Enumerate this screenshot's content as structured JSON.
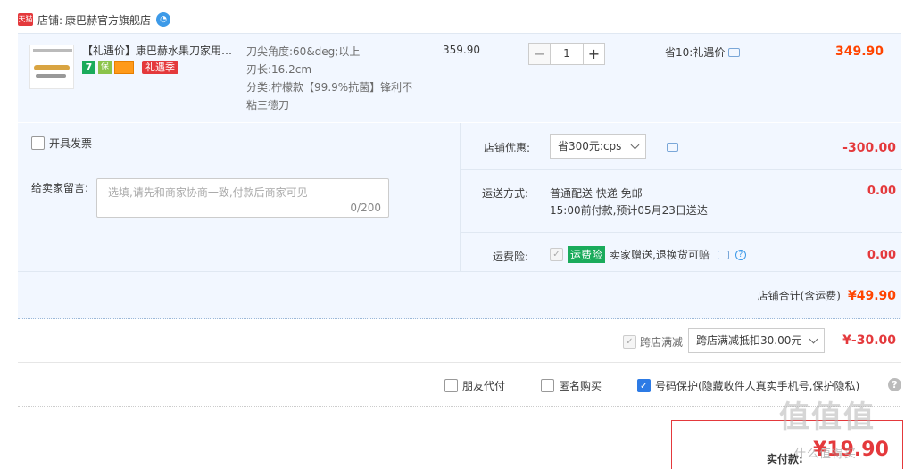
{
  "shop": {
    "tmall_badge": "天猫",
    "label": "店铺:",
    "name": "康巴赫官方旗舰店"
  },
  "item": {
    "title": "【礼遇价】康巴赫水果刀家用菜…",
    "badges": [
      "7",
      "保",
      "",
      "礼遇季"
    ],
    "sku_lines": [
      "刀尖角度:60&deg;以上",
      "刃长:16.2cm",
      "分类:柠檬款【99.9%抗菌】锋利不粘三德刀"
    ],
    "unit_price": "359.90",
    "quantity": "1",
    "minus": "−",
    "plus": "+",
    "saving": "省10:礼遇价",
    "total": "349.90"
  },
  "options": {
    "invoice": "开具发票",
    "memo_label": "给卖家留言:",
    "memo_placeholder": "选填,请先和商家协商一致,付款后商家可见",
    "memo_count": "0/200",
    "shop_discount_label": "店铺优惠:",
    "shop_discount_select": "省300元:cps",
    "shop_discount_value": "-300.00",
    "shipping_label": "运送方式:",
    "shipping_method": "普通配送 快递 免邮",
    "shipping_eta": "15:00前付款,预计05月23日送达",
    "shipping_value": "0.00",
    "insurance_label": "运费险:",
    "insurance_badge": "运费险",
    "insurance_text": "卖家赠送,退换货可赔",
    "insurance_value": "0.00",
    "subtotal_label": "店铺合计(含运费)",
    "subtotal_value": "¥49.90"
  },
  "cross_store": {
    "label": "跨店满减",
    "select": "跨店满减抵扣30.00元",
    "value": "¥-30.00"
  },
  "extra_options": {
    "friend_pay": "朋友代付",
    "anonymous": "匿名购买",
    "number_protect": "号码保护(隐藏收件人真实手机号,保护隐私)"
  },
  "payment": {
    "label": "实付款:",
    "amount": "¥19.90"
  },
  "watermark": {
    "logo": "值值值",
    "site": "什么值得买"
  }
}
